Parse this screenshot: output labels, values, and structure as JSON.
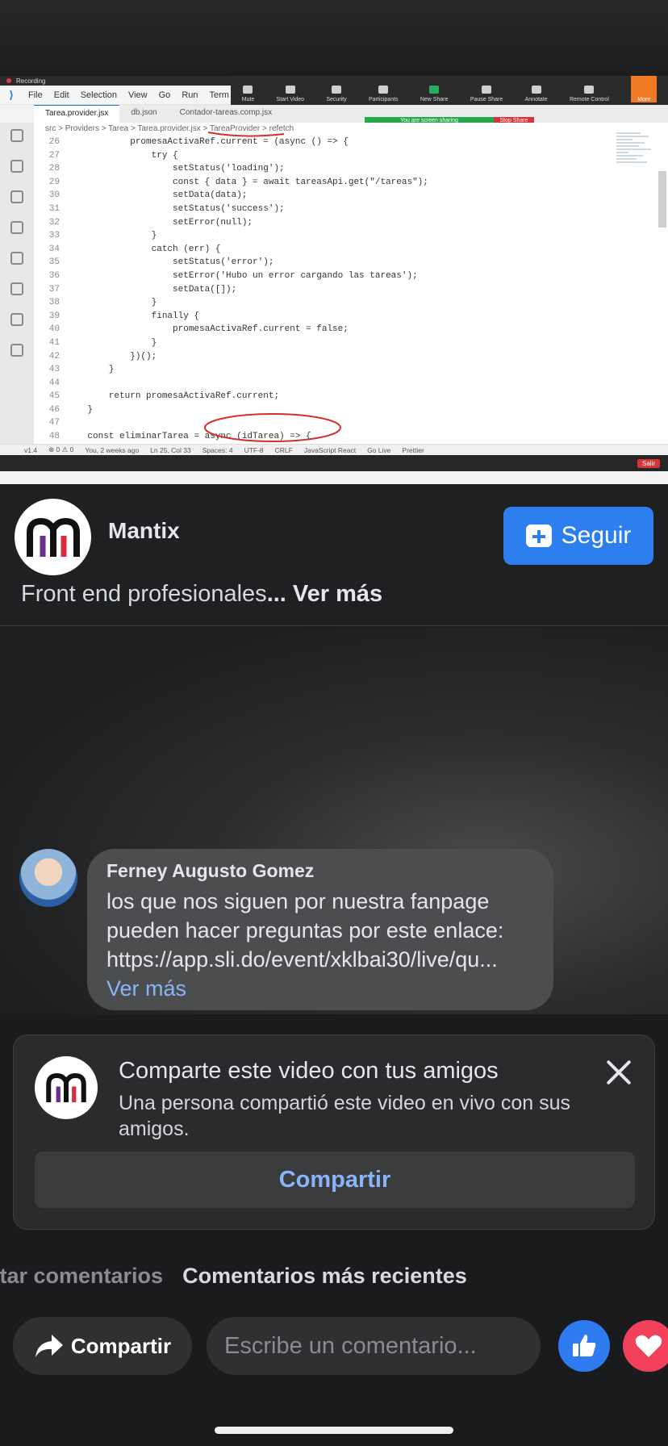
{
  "screen_share": {
    "recording_label": "Recording",
    "menu": [
      "File",
      "Edit",
      "Selection",
      "View",
      "Go",
      "Run",
      "Term"
    ],
    "zoom_tools": [
      "Mute",
      "Start Video",
      "Security",
      "Participants",
      "New Share",
      "Pause Share",
      "Annotate",
      "Remote Control",
      "More"
    ],
    "sharing_banner": "You are screen sharing",
    "stop_share": "Stop Share",
    "tabs": [
      "Tarea.provider.jsx",
      "db.json",
      "Contador-tareas.comp.jsx"
    ],
    "breadcrumb": "src > Providers > Tarea > Tarea.provider.jsx > TareaProvider > refetch",
    "code_lines": [
      {
        "n": "26",
        "t": "            promesaActivaRef.current = (async () => {"
      },
      {
        "n": "27",
        "t": "                try {"
      },
      {
        "n": "28",
        "t": "                    setStatus('loading');"
      },
      {
        "n": "29",
        "t": "                    const { data } = await tareasApi.get(\"/tareas\");"
      },
      {
        "n": "30",
        "t": "                    setData(data);"
      },
      {
        "n": "31",
        "t": "                    setStatus('success');"
      },
      {
        "n": "32",
        "t": "                    setError(null);"
      },
      {
        "n": "33",
        "t": "                }"
      },
      {
        "n": "34",
        "t": "                catch (err) {"
      },
      {
        "n": "35",
        "t": "                    setStatus('error');"
      },
      {
        "n": "36",
        "t": "                    setError('Hubo un error cargando las tareas');"
      },
      {
        "n": "37",
        "t": "                    setData([]);"
      },
      {
        "n": "38",
        "t": "                }"
      },
      {
        "n": "39",
        "t": "                finally {"
      },
      {
        "n": "40",
        "t": "                    promesaActivaRef.current = false;"
      },
      {
        "n": "41",
        "t": "                }"
      },
      {
        "n": "42",
        "t": "            })();"
      },
      {
        "n": "43",
        "t": "        }"
      },
      {
        "n": "44",
        "t": ""
      },
      {
        "n": "45",
        "t": "        return promesaActivaRef.current;"
      },
      {
        "n": "46",
        "t": "    }"
      },
      {
        "n": "47",
        "t": ""
      },
      {
        "n": "48",
        "t": "    const eliminarTarea = async (idTarea) => {"
      }
    ],
    "status_items": [
      "v1.4",
      "⊗ 0 ⚠ 0",
      "You, 2 weeks ago",
      "Ln 25, Col 33",
      "Spaces: 4",
      "UTF-8",
      "CRLF",
      "JavaScript React",
      "Go Live",
      "Prettier"
    ],
    "salir": "Salir"
  },
  "page": {
    "name": "Mantix",
    "follow_label": "Seguir",
    "description": "Front end profesionales",
    "see_more": "... Ver más"
  },
  "comment": {
    "author": "Ferney Augusto Gomez",
    "lines": [
      "los que nos siguen por nuestra fanpage",
      "pueden hacer preguntas por este enlace:",
      "https://app.sli.do/event/xklbai30/live/qu..."
    ],
    "see_more": "Ver más"
  },
  "share_panel": {
    "title": "Comparte este video con tus amigos",
    "subtitle": "Una persona compartió este video en vivo con sus amigos.",
    "button": "Compartir"
  },
  "comment_tabs": {
    "hidden": "ltar comentarios",
    "recent": "Comentarios más recientes"
  },
  "actions": {
    "share": "Compartir",
    "comment_placeholder": "Escribe un comentario..."
  },
  "colors": {
    "accent": "#2d7ff0",
    "link": "#8ab4f8",
    "love": "#f2405b"
  }
}
